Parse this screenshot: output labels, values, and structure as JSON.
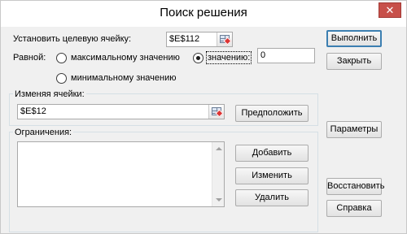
{
  "window": {
    "title": "Поиск решения",
    "close_symbol": "✕"
  },
  "target": {
    "label": "Установить целевую ячейку:",
    "value": "$E$112"
  },
  "equal": {
    "label": "Равной:",
    "option_max": "максимальному значению",
    "option_value": "значению:",
    "value_input": "0",
    "option_min": "минимальному значению",
    "selected": "value"
  },
  "changing": {
    "label": "Изменяя ячейки:",
    "value": "$E$12",
    "guess_button": "Предположить"
  },
  "constraints": {
    "label": "Ограничения:",
    "items": [],
    "add_button": "Добавить",
    "change_button": "Изменить",
    "delete_button": "Удалить"
  },
  "actions": {
    "run_button": "Выполнить",
    "close_button": "Закрыть",
    "options_button": "Параметры",
    "reset_button": "Восстановить",
    "help_button": "Справка"
  },
  "colors": {
    "close_button_bg": "#c7504a",
    "default_button_border": "#3c7fb1"
  }
}
